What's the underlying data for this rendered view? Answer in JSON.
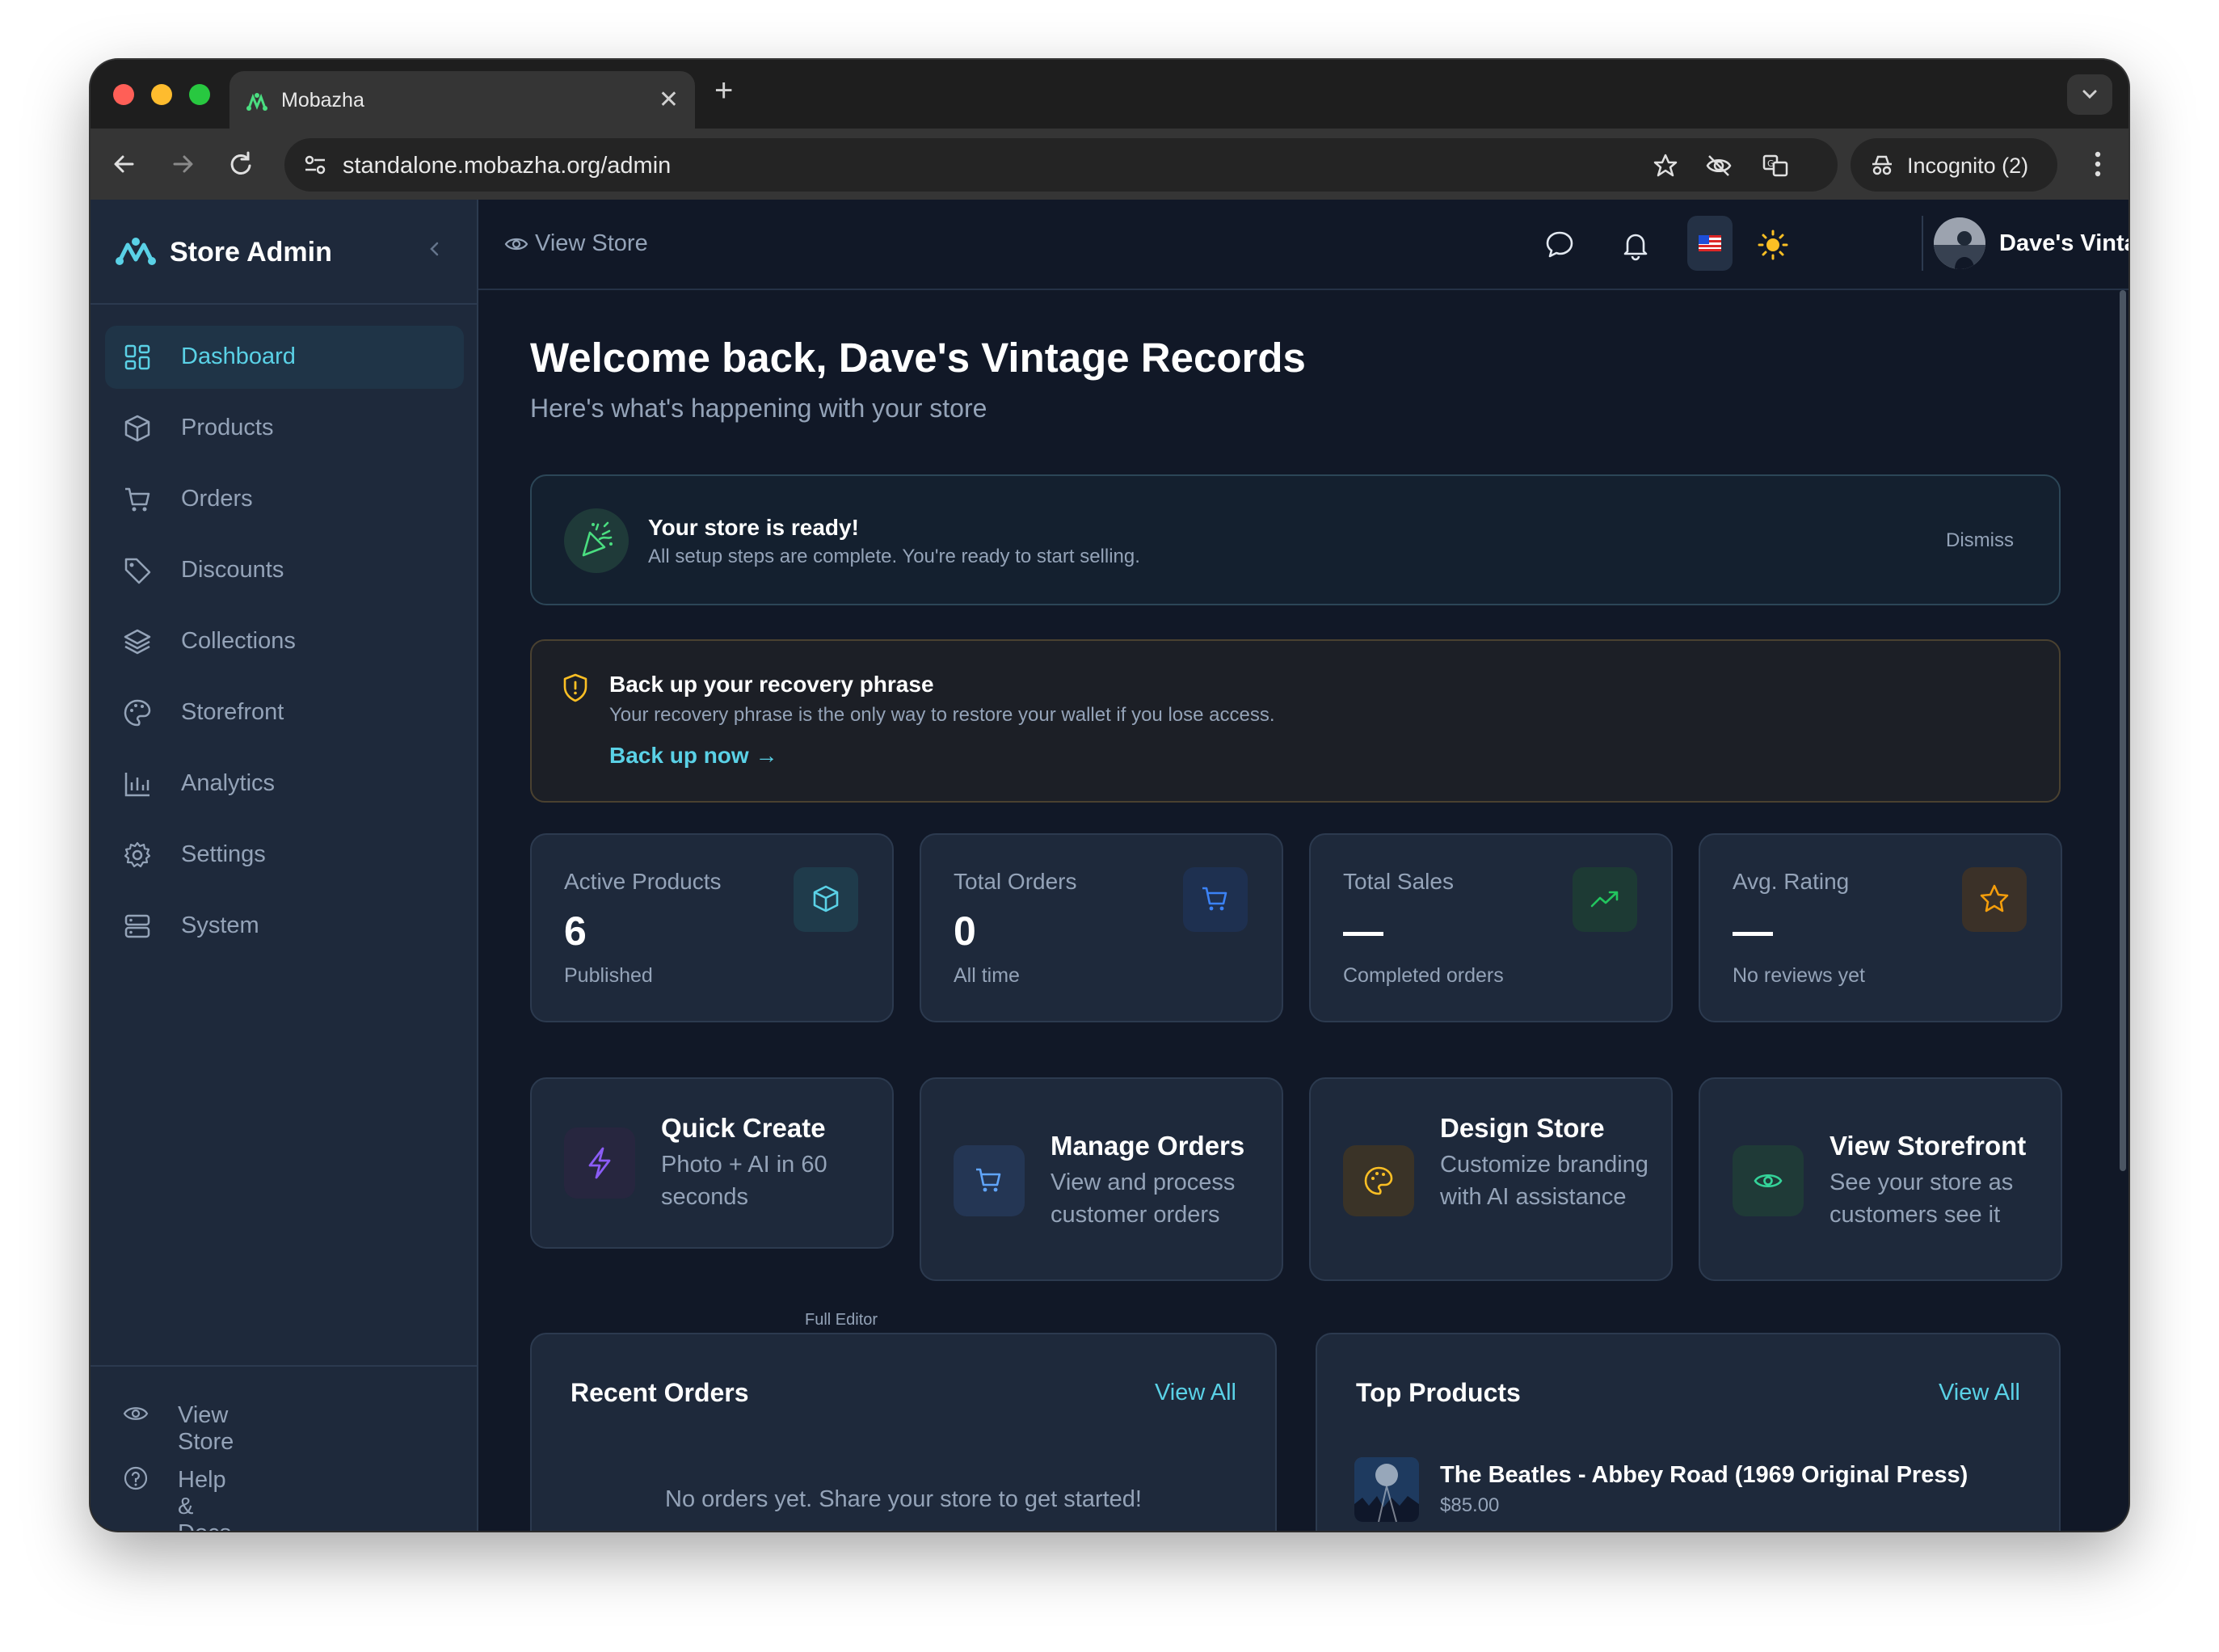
{
  "browser": {
    "tab_title": "Mobazha",
    "url": "standalone.mobazha.org/admin",
    "incognito_label": "Incognito (2)"
  },
  "sidebar": {
    "brand": "Store Admin",
    "items": [
      {
        "label": "Dashboard",
        "icon": "dashboard-icon",
        "active": true
      },
      {
        "label": "Products",
        "icon": "box-icon"
      },
      {
        "label": "Orders",
        "icon": "cart-icon"
      },
      {
        "label": "Discounts",
        "icon": "tag-icon"
      },
      {
        "label": "Collections",
        "icon": "layers-icon"
      },
      {
        "label": "Storefront",
        "icon": "palette-icon"
      },
      {
        "label": "Analytics",
        "icon": "bar-chart-icon"
      },
      {
        "label": "Settings",
        "icon": "gear-icon"
      },
      {
        "label": "System",
        "icon": "server-icon"
      }
    ],
    "footer": [
      {
        "label": "View Store",
        "icon": "eye-icon"
      },
      {
        "label": "Help & Docs",
        "icon": "help-icon"
      }
    ]
  },
  "topbar": {
    "view_store": "View Store",
    "store_name": "Dave's Vintage ..."
  },
  "welcome": {
    "title": "Welcome back, Dave's Vintage Records",
    "subtitle": "Here's what's happening with your store"
  },
  "ready_banner": {
    "title": "Your store is ready!",
    "subtitle": "All setup steps are complete. You're ready to start selling.",
    "dismiss": "Dismiss"
  },
  "backup_banner": {
    "title": "Back up your recovery phrase",
    "subtitle": "Your recovery phrase is the only way to restore your wallet if you lose access.",
    "link": "Back up now →"
  },
  "stats": [
    {
      "label": "Active Products",
      "value": "6",
      "sub": "Published",
      "icon": "box-icon",
      "accent": "#5ad1e6"
    },
    {
      "label": "Total Orders",
      "value": "0",
      "sub": "All time",
      "icon": "cart-icon",
      "accent": "#3b82f6"
    },
    {
      "label": "Total Sales",
      "value": "—",
      "sub": "Completed orders",
      "icon": "trending-up-icon",
      "accent": "#22c55e"
    },
    {
      "label": "Avg. Rating",
      "value": "—",
      "sub": "No reviews yet",
      "icon": "star-icon",
      "accent": "#f59e0b"
    }
  ],
  "quick_actions": [
    {
      "title": "Quick Create",
      "sub": "Photo + AI in 60 seconds",
      "icon": "lightning-icon",
      "accent": "#8b5cf6",
      "note": "Full Editor"
    },
    {
      "title": "Manage Orders",
      "sub": "View and process customer orders",
      "icon": "cart-icon",
      "accent": "#60a5fa"
    },
    {
      "title": "Design Store",
      "sub": "Customize branding with AI assistance",
      "icon": "palette-icon",
      "accent": "#fbbf24"
    },
    {
      "title": "View Storefront",
      "sub": "See your store as customers see it",
      "icon": "eye-icon",
      "accent": "#34d399"
    }
  ],
  "recent_orders": {
    "title": "Recent Orders",
    "link": "View All",
    "empty": "No orders yet. Share your store to get started!"
  },
  "top_products": {
    "title": "Top Products",
    "link": "View All",
    "items": [
      {
        "name": "The Beatles - Abbey Road (1969 Original Press)",
        "price": "$85.00"
      }
    ]
  },
  "colors": {
    "accent": "#5ad1e6",
    "background": "#111827",
    "surface": "#1e293b"
  }
}
